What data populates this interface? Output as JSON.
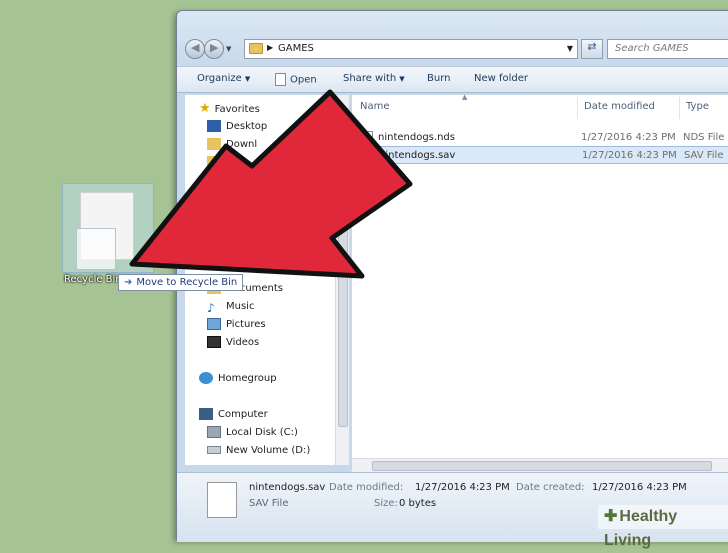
{
  "address": {
    "path": "GAMES",
    "search_placeholder": "Search GAMES"
  },
  "toolbar": {
    "organize": "Organize",
    "open": "Open",
    "share_with": "Share with",
    "burn": "Burn",
    "new_folder": "New folder"
  },
  "nav": {
    "favorites": "Favorites",
    "items": [
      "Desktop",
      "Downl",
      "Re",
      "Documents",
      "Music",
      "Pictures",
      "Videos"
    ],
    "homegroup": "Homegroup",
    "computer": "Computer",
    "drives": [
      "Local Disk (C:)",
      "New Volume (D:)"
    ]
  },
  "columns": {
    "name": "Name",
    "date": "Date modified",
    "type": "Type"
  },
  "files": [
    {
      "name": "nintendogs.nds",
      "date": "1/27/2016 4:23 PM",
      "type": "NDS File"
    },
    {
      "name": "nintendogs.sav",
      "date": "1/27/2016 4:23 PM",
      "type": "SAV File"
    }
  ],
  "details": {
    "name": "nintendogs.sav",
    "type": "SAV File",
    "date_modified_label": "Date modified:",
    "date_modified": "1/27/2016 4:23 PM",
    "date_created_label": "Date created:",
    "date_created": "1/27/2016 4:23 PM",
    "size_label": "Size:",
    "size": "0 bytes"
  },
  "desktop": {
    "recycle_bin_label": "Recycle Bin",
    "tooltip": "Move to Recycle Bin"
  },
  "annotation_color": "#e0283a",
  "watermark": "Healthy Living"
}
